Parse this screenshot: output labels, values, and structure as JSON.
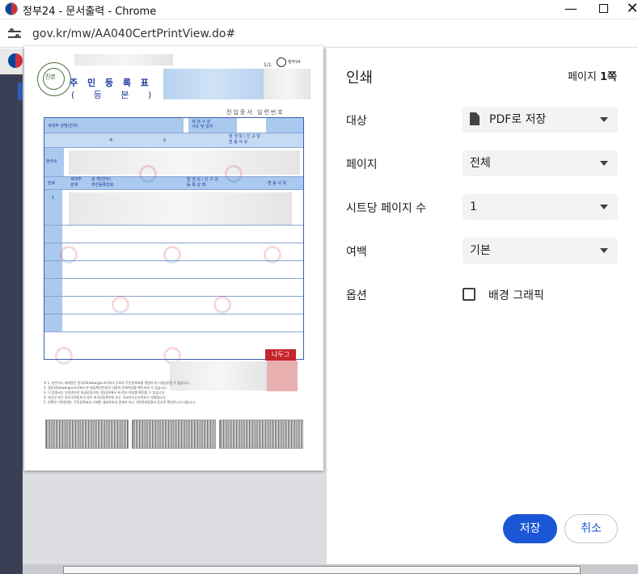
{
  "window": {
    "title": "정부24 - 문서출력 - Chrome",
    "minimize": "—",
    "close": "✕"
  },
  "address": {
    "url": "gov.kr/mw/AA040CertPrintView.do#"
  },
  "document": {
    "title": "주 민 등 록 표",
    "subtitle": "( 등 본 )",
    "page_number": "1/1",
    "serial": "전입증서 일련번호",
    "header_labels": {
      "householder": "세대주 성명(한자)",
      "household_reason": "세 대 구 성\n사유 및 일자",
      "address_head": "주 소",
      "report_head": "발 생 일 / 신 고 일\n변 동 사 유",
      "current_address": "현주소",
      "no": "번호",
      "relation": "세대주\n관계",
      "name_id": "성 명(한자)\n주민등록번호",
      "date_status": "발 생 일 / 신 고 일\n등 록 상 태",
      "change_reason": "변 동 사 유",
      "row1": "1"
    },
    "stamp": "나두그",
    "footnotes": [
      "※ 1. 본인이나 세대원은 정부24(www.gov.kr)에서 무료로 주민등록표를 열람하거나 발급받을 수 있습니다.",
      "2. 정부24(www.gov.kr)에서 본 발급확인번호로 내용의 진위여부를 확인하실 수 있습니다.",
      "3. 이 증명서는 인터넷으로 발급되었으며, 정부24에서 위·변조 여부를 확인할 수 있습니다.",
      "4. 외국인 또는 외국국적동포의 경우 외국인등록번호 또는 국내거소신고번호가 기재됩니다.",
      "5. 정확한 가족관계는 주민등록표상 기재된 세대주와의 관계가 아닌 가족관계증명서 등으로 확인하시기 바랍니다."
    ]
  },
  "panel": {
    "title": "인쇄",
    "page_count_prefix": "페이지 ",
    "page_count_value": "1쪽",
    "destination": {
      "label": "대상",
      "value": "PDF로 저장"
    },
    "pages": {
      "label": "페이지",
      "value": "전체"
    },
    "pages_per_sheet": {
      "label": "시트당 페이지 수",
      "value": "1"
    },
    "margins": {
      "label": "여백",
      "value": "기본"
    },
    "options": {
      "label": "옵션",
      "background_graphics": "배경 그래픽",
      "background_graphics_checked": false
    },
    "save_button": "저장",
    "cancel_button": "취소"
  },
  "colors": {
    "primary_button": "#1a56d6",
    "select_bg": "#f1f3f4",
    "doc_blue": "#1b3a9a"
  }
}
